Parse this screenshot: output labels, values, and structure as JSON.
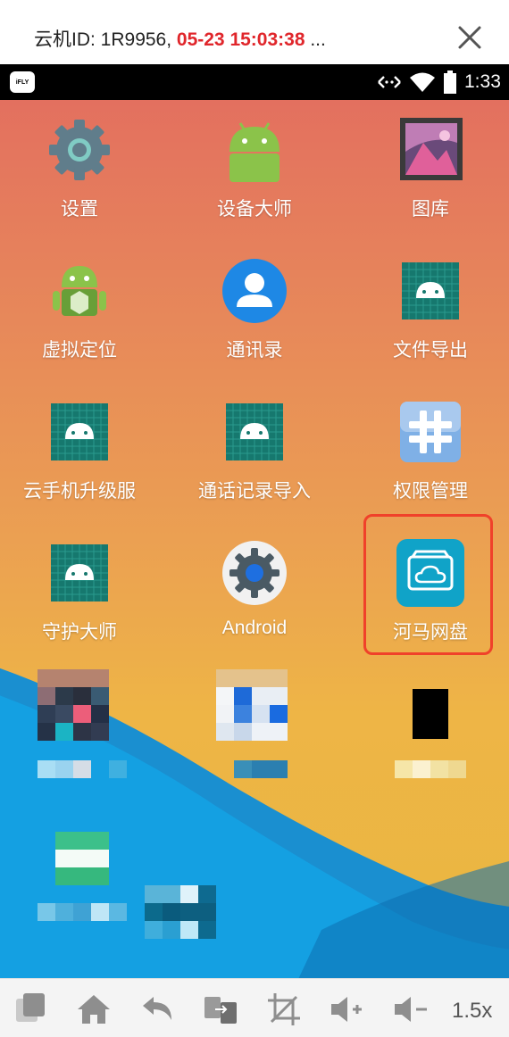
{
  "header": {
    "title_prefix": "云机ID: 1R9956, ",
    "title_time": "05-23 15:03:38",
    "title_suffix": " ..."
  },
  "statusbar": {
    "logo_text": "iFLY",
    "time": "1:33"
  },
  "apps": [
    {
      "label": "设置",
      "icon": "settings-gear-icon"
    },
    {
      "label": "设备大师",
      "icon": "android-robot-icon"
    },
    {
      "label": "图库",
      "icon": "gallery-icon"
    },
    {
      "label": "虚拟定位",
      "icon": "android-box-icon"
    },
    {
      "label": "通讯录",
      "icon": "contacts-icon"
    },
    {
      "label": "文件导出",
      "icon": "android-default-icon"
    },
    {
      "label": "云手机升级服",
      "icon": "android-default-icon"
    },
    {
      "label": "通话记录导入",
      "icon": "android-default-icon"
    },
    {
      "label": "权限管理",
      "icon": "hash-icon"
    },
    {
      "label": "守护大师",
      "icon": "android-default-icon"
    },
    {
      "label": "Android",
      "icon": "android-settings-icon"
    },
    {
      "label": "河马网盘",
      "icon": "cloud-drive-icon"
    }
  ],
  "toolbar": {
    "zoom_label": "1.5x",
    "buttons": [
      "copy-icon",
      "home-icon",
      "back-icon",
      "switch-icon",
      "crop-icon",
      "volume-up-icon",
      "volume-down-icon"
    ]
  },
  "colors": {
    "highlight": "#f0412a",
    "time_red": "#e0262b"
  }
}
